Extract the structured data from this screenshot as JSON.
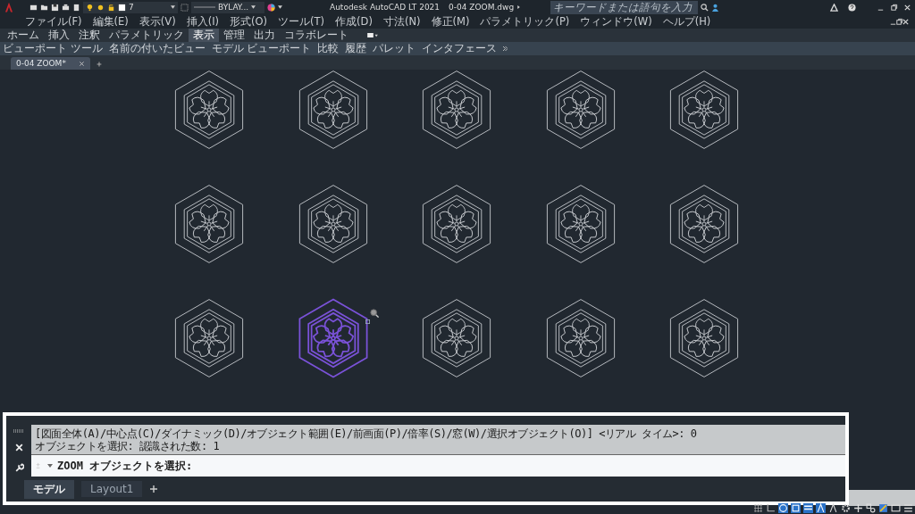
{
  "title_bar": {
    "app_title": "Autodesk AutoCAD LT 2021",
    "file_name": "0-04 ZOOM.dwg",
    "search": {
      "placeholder": "キーワードまたは語句を入力"
    }
  },
  "quick_access": {
    "layer": "7",
    "linetype": "BYLAY..."
  },
  "menu_bar": [
    "ファイル(F)",
    "編集(E)",
    "表示(V)",
    "挿入(I)",
    "形式(O)",
    "ツール(T)",
    "作成(D)",
    "寸法(N)",
    "修正(M)",
    "パラメトリック(P)",
    "ウィンドウ(W)",
    "ヘルプ(H)"
  ],
  "ribbon_tabs": [
    {
      "label": "ホーム",
      "selected": false
    },
    {
      "label": "挿入",
      "selected": false
    },
    {
      "label": "注釈",
      "selected": false
    },
    {
      "label": "パラメトリック",
      "selected": false
    },
    {
      "label": "表示",
      "selected": true
    },
    {
      "label": "管理",
      "selected": false
    },
    {
      "label": "出力",
      "selected": false
    },
    {
      "label": "コラボレート",
      "selected": false
    }
  ],
  "ribbon_panels": [
    "ビューポート ツール",
    "名前の付いたビュー",
    "モデル ビューポート",
    "比較",
    "履歴",
    "パレット",
    "インタフェース"
  ],
  "file_tabs": [
    {
      "label": "0-04 ZOOM*",
      "selected": true
    }
  ],
  "drawing": {
    "symbols": [
      {
        "selected": false
      },
      {
        "selected": false
      },
      {
        "selected": false
      },
      {
        "selected": false
      },
      {
        "selected": false
      },
      {
        "selected": false
      },
      {
        "selected": false
      },
      {
        "selected": false
      },
      {
        "selected": false
      },
      {
        "selected": false
      },
      {
        "selected": false
      },
      {
        "selected": true
      },
      {
        "selected": false
      },
      {
        "selected": false
      },
      {
        "selected": false
      }
    ]
  },
  "command_line": {
    "history": [
      "[図面全体(A)/中心点(C)/ダイナミック(D)/オブジェクト範囲(E)/前画面(P)/倍率(S)/窓(W)/選択オブジェクト(O)] <リアル タイム>: 0",
      "オブジェクトを選択: 認識された数: 1"
    ],
    "prompt": "ZOOM オブジェクトを選択:"
  },
  "layout_tabs": [
    {
      "label": "モデル",
      "selected": true
    },
    {
      "label": "Layout1",
      "selected": false
    }
  ]
}
